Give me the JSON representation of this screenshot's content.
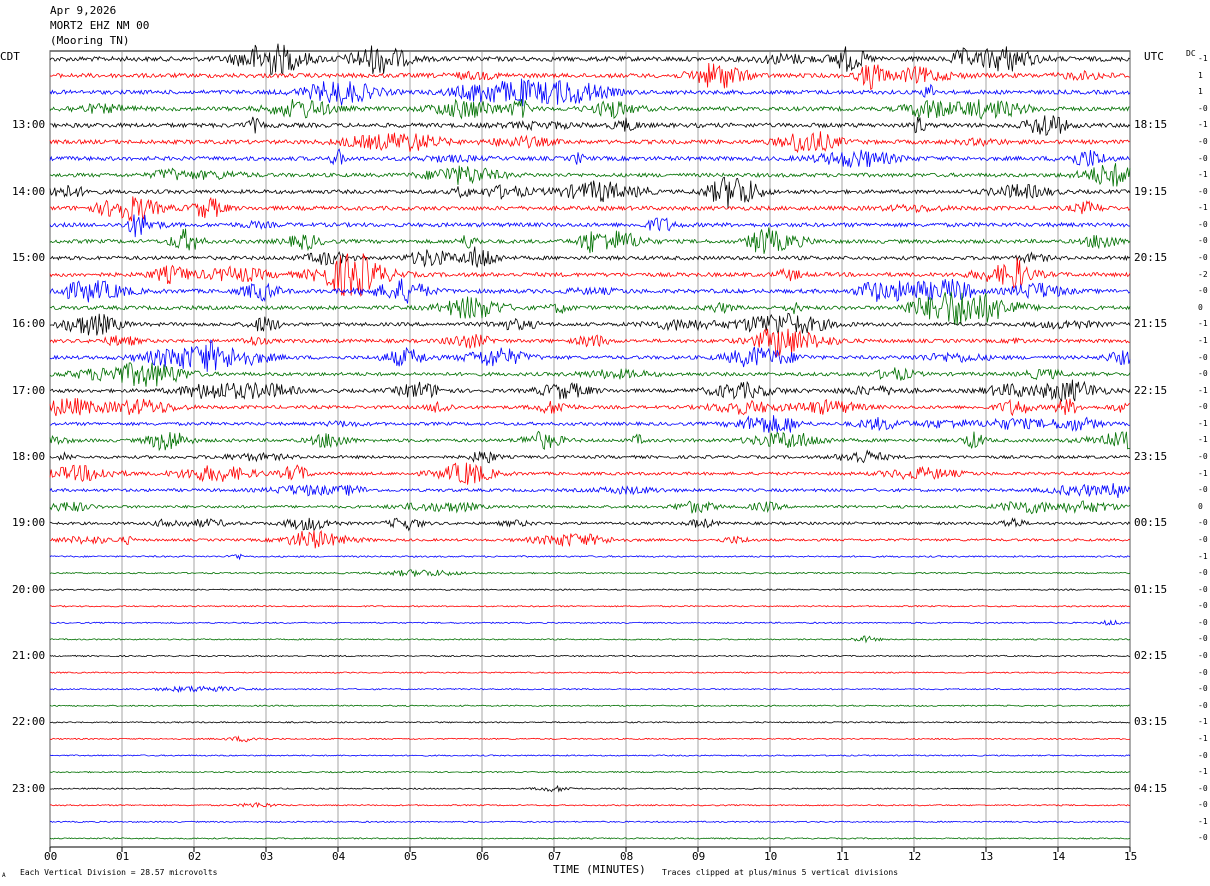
{
  "header": {
    "date": "Apr 9,2026",
    "station": "MORT2 EHZ NM 00",
    "location": "(Mooring TN)"
  },
  "left_timezone": "CDT",
  "right_timezone": "UTC",
  "dc_label": "DC",
  "footer": {
    "xlabel": "TIME (MINUTES)",
    "scale_note": "Each Vertical Division =   28.57 microvolts",
    "clip_note": "Traces clipped at plus/minus 5 vertical divisions",
    "corner_mark": "A"
  },
  "colors": {
    "cycle": [
      "#000000",
      "#ff0000",
      "#0000ff",
      "#007000"
    ],
    "grid": "#808080"
  },
  "chart_data": {
    "type": "line",
    "kind": "helicorder",
    "xlabel": "TIME (MINUTES)",
    "xlim": [
      0,
      15
    ],
    "x_ticks": [
      "00",
      "01",
      "02",
      "03",
      "04",
      "05",
      "06",
      "07",
      "08",
      "09",
      "10",
      "11",
      "12",
      "13",
      "14",
      "15"
    ],
    "rows_per_hour": 4,
    "hours_cdt": [
      "13:00",
      "14:00",
      "15:00",
      "16:00",
      "17:00",
      "18:00",
      "19:00",
      "20:00",
      "21:00",
      "22:00",
      "23:00"
    ],
    "hours_utc": [
      "18:15",
      "19:15",
      "20:15",
      "21:15",
      "22:15",
      "23:15",
      "00:15",
      "01:15",
      "02:15",
      "03:15",
      "04:15"
    ],
    "row_count": 48,
    "dc_offsets": [
      "-1",
      "1",
      "1",
      "-0",
      "-1",
      "-0",
      "-0",
      "-1",
      "-0",
      "-1",
      "-0",
      "-0",
      "-0",
      "-2",
      "-0",
      "0",
      "-1",
      "-1",
      "-0",
      "-0",
      "-1",
      "-0",
      "-1",
      "-1",
      "-0",
      "-1",
      "-0",
      "0",
      "-0",
      "-0",
      "-1",
      "-0",
      "-0",
      "-0",
      "-0",
      "-0",
      "-0",
      "-0",
      "-0",
      "-0",
      "-1",
      "-1",
      "-0",
      "-1",
      "-0",
      "-0",
      "-1",
      "-0"
    ],
    "activity_level": [
      1.3,
      1.2,
      1.1,
      1.1,
      1.2,
      1.1,
      1.1,
      1.0,
      1.0,
      1.1,
      1.1,
      1.0,
      1.0,
      1.1,
      1.1,
      1.0,
      0.9,
      0.9,
      0.9,
      0.9,
      0.9,
      0.8,
      0.8,
      0.8,
      0.7,
      0.7,
      0.7,
      0.6,
      0.6,
      0.5,
      0.2,
      0.15,
      0.12,
      0.12,
      0.12,
      0.11,
      0.12,
      0.11,
      0.11,
      0.11,
      0.11,
      0.11,
      0.11,
      0.11,
      0.11,
      0.11,
      0.11,
      0.11
    ],
    "clip_divisions": 5,
    "division_microvolts": 28.57
  }
}
